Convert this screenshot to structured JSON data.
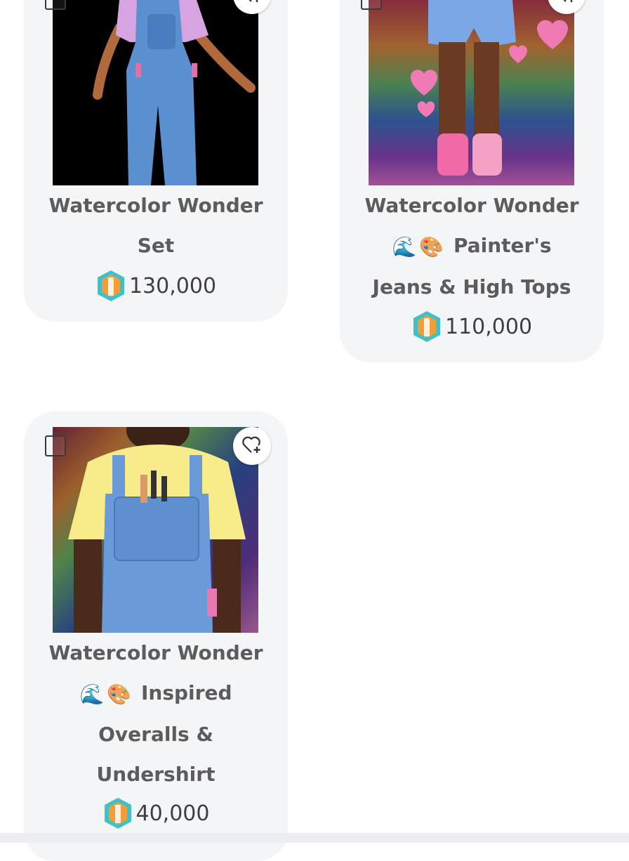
{
  "colors": {
    "card_bg": "#f4f5f7",
    "title_text": "#5c5c5c",
    "price_text": "#3f3f3f",
    "coin_teal": "#3fc1c9",
    "coin_orange": "#f29d38"
  },
  "items": [
    {
      "title_lines": [
        "Watercolor Wonder",
        "Set"
      ],
      "price": "130,000",
      "currency_icon": "coin-icon",
      "favorite_icon": "heart-plus-icon",
      "select_icon": "checkbox-icon"
    },
    {
      "title_lines": [
        "Watercolor Wonder",
        "Painter's",
        "Jeans & High Tops"
      ],
      "emojis": [
        "🌊",
        "🎨"
      ],
      "price": "110,000",
      "currency_icon": "coin-icon",
      "favorite_icon": "heart-plus-icon",
      "select_icon": "checkbox-icon"
    },
    {
      "title_lines": [
        "Watercolor Wonder",
        "Inspired",
        "Overalls &",
        "Undershirt"
      ],
      "emojis": [
        "🌊",
        "🎨"
      ],
      "price": "40,000",
      "currency_icon": "coin-icon",
      "favorite_icon": "heart-plus-icon",
      "select_icon": "checkbox-icon"
    }
  ]
}
